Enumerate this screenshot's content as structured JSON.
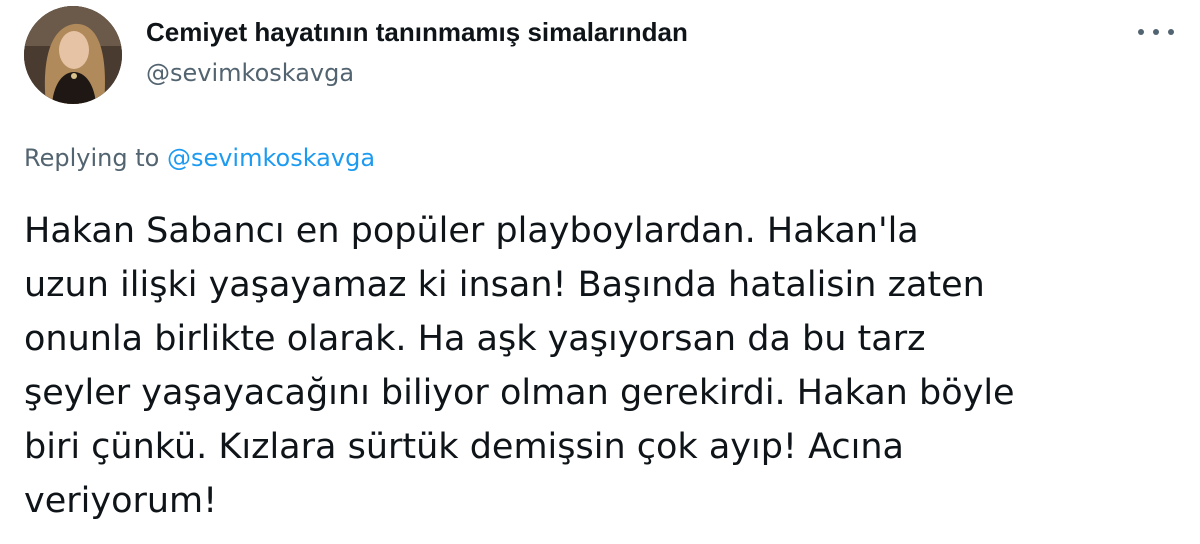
{
  "tweet": {
    "author": {
      "display_name": "Cemiyet hayatının tanınmamış simalarından",
      "handle": "@sevimkoskavga",
      "avatar_icon": "profile-photo"
    },
    "more_icon": "more-horizontal-icon",
    "reply": {
      "prefix": "Replying to",
      "mention": "@sevimkoskavga"
    },
    "text": "Hakan Sabancı en popüler playboylardan. Hakan'la\nuzun ilişki yaşayamaz ki insan! Başında hatalisin zaten\nonunla birlikte olarak. Ha aşk yaşıyorsan da bu tarz\nşeyler yaşayacağını biliyor olman gerekirdi. Hakan böyle\nbiri çünkü. Kızlara sürtük demişsin çok ayıp! Acına\nveriyorum!"
  },
  "colors": {
    "text_primary": "#0f1419",
    "text_secondary": "#536471",
    "link": "#1d9bf0",
    "background": "#ffffff"
  }
}
